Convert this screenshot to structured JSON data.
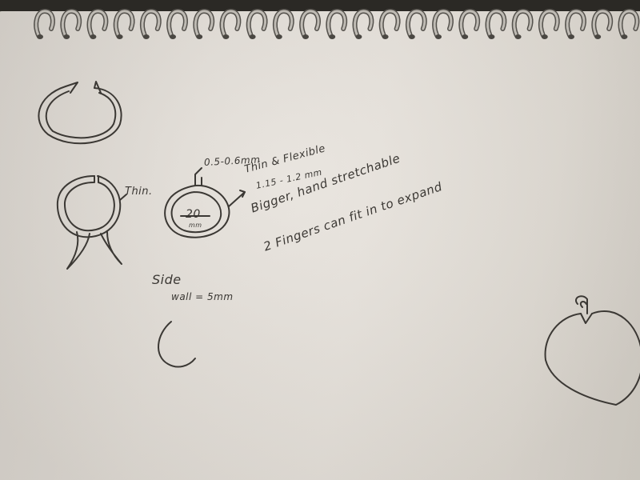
{
  "annotations": {
    "thin_left": "Thin.",
    "gap": "0.5-0.6mm",
    "thin_flexible": "Thin & Flexible",
    "thickness": "1.15 - 1.2 mm",
    "size_value": "20",
    "size_unit": "mm",
    "stretch": "Bigger, hand stretchable",
    "fingers": "2 Fingers can fit in to expand",
    "side_label": "Side",
    "wall": "wall = 5mm"
  },
  "colors": {
    "ink": "#3b3834",
    "paper": "#e2ddd6",
    "background": "#2b2925",
    "spiral_metal": "#bfbbb4"
  }
}
